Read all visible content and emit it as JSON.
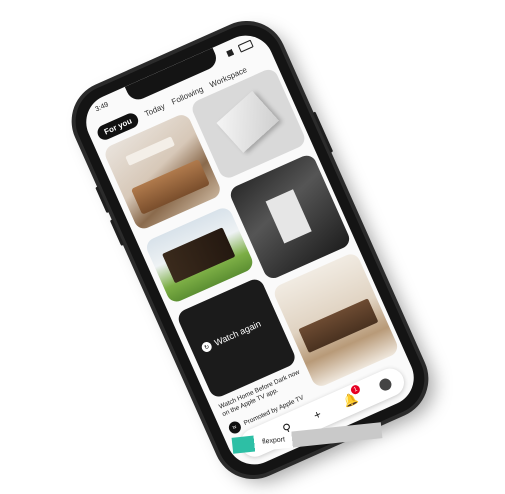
{
  "status": {
    "time": "3:49"
  },
  "tabs": [
    "For you",
    "Today",
    "Following",
    "Workspace"
  ],
  "pins": {
    "watch_again": "Watch again",
    "caption": "Watch Home Before Dark now on the Apple TV app.",
    "promoted": "Promoted by Apple TV",
    "apple_tv_logo": "tv"
  },
  "nav": {
    "notification_count": "1"
  },
  "sticker_text": "flexport",
  "colors": {
    "brand_red": "#e60023",
    "accent_teal": "#2dbfa5"
  },
  "icons": [
    "home-icon",
    "search-icon",
    "plus-icon",
    "bell-icon",
    "avatar"
  ]
}
